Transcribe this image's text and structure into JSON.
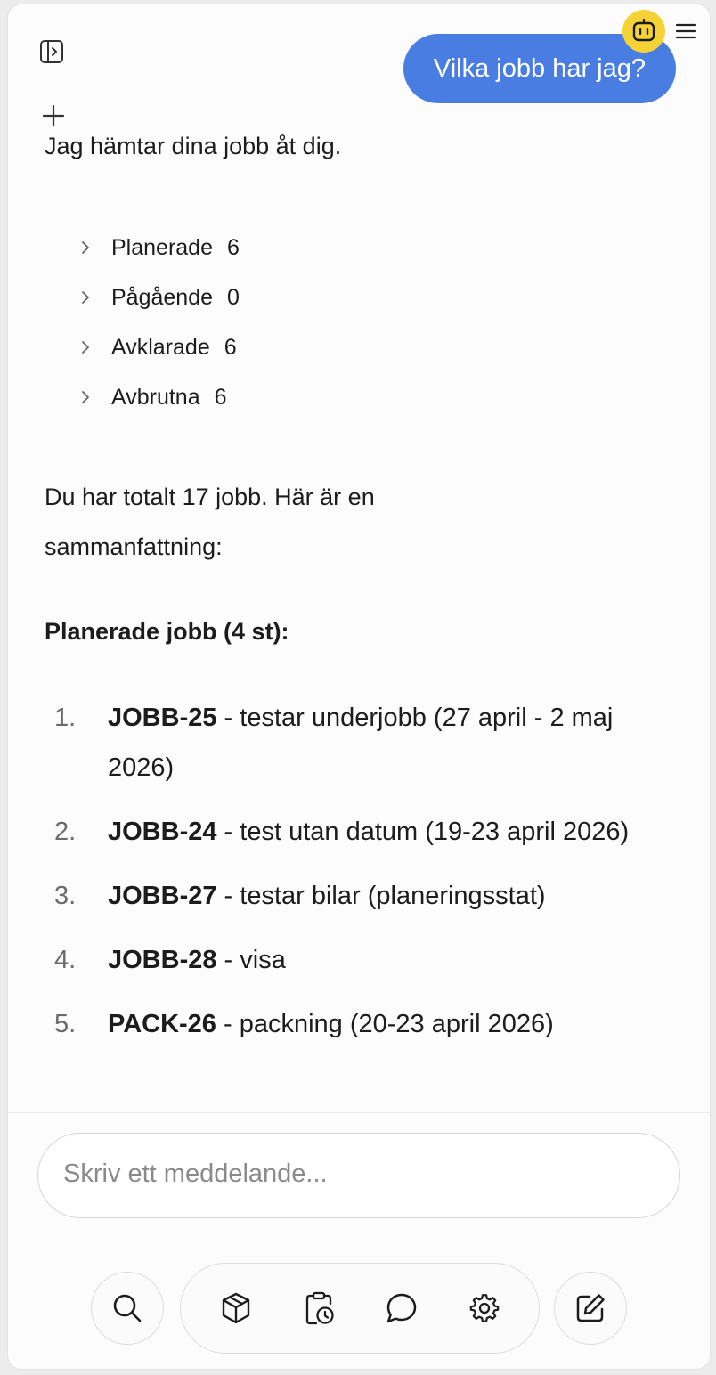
{
  "header": {
    "sidebar_toggle_icon": "sidebar-toggle-icon",
    "new_chat_icon": "plus-icon",
    "bot_avatar_icon": "robot-icon",
    "menu_icon": "hamburger-menu-icon",
    "bot_badge_color": "#f5d336"
  },
  "conversation": {
    "user_message": "Vilka jobb har jag?",
    "user_bubble_color": "#4a7de2",
    "assistant_status": "Jag hämtar dina jobb åt dig.",
    "job_groups": [
      {
        "label": "Planerade",
        "count": "6"
      },
      {
        "label": "Pågående",
        "count": "0"
      },
      {
        "label": "Avklarade",
        "count": "6"
      },
      {
        "label": "Avbrutna",
        "count": "6"
      }
    ],
    "summary": "Du har totalt 17 jobb. Här är en sammanfattning:",
    "planned_heading": "Planerade jobb (4 st):",
    "jobs": [
      {
        "num": "1.",
        "code": "JOBB-25",
        "desc": " - testar underjobb (27 april - 2 maj 2026)"
      },
      {
        "num": "2.",
        "code": "JOBB-24",
        "desc": " - test utan datum (19-23 april 2026)"
      },
      {
        "num": "3.",
        "code": "JOBB-27",
        "desc": " - testar bilar (planeringsstat)"
      },
      {
        "num": "4.",
        "code": "JOBB-28",
        "desc": " - visa"
      },
      {
        "num": "5.",
        "code": "PACK-26",
        "desc": " - packning (20-23 april 2026)"
      }
    ]
  },
  "composer": {
    "placeholder": "Skriv ett meddelande..."
  },
  "toolbar": {
    "icons": [
      "search-icon",
      "package-icon",
      "clipboard-clock-icon",
      "chat-bubble-icon",
      "gear-icon",
      "edit-icon"
    ]
  }
}
